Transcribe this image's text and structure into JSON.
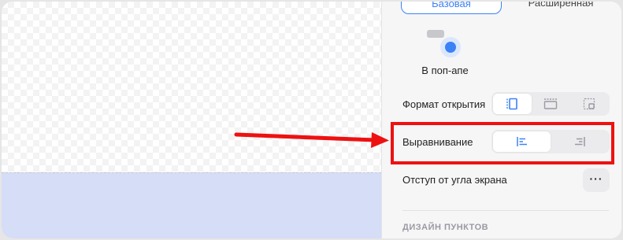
{
  "settings": {
    "tabs": {
      "basic": "Базовая",
      "extended": "Расширенная"
    },
    "display_mode": {
      "label": "В поп-апе",
      "icon": "popup-mode-icon"
    },
    "open_format": {
      "label": "Формат открытия",
      "options": [
        "sidebar-open-icon",
        "top-panel-icon",
        "corner-popup-icon"
      ],
      "selected": 0
    },
    "alignment": {
      "label": "Выравнивание",
      "options": [
        "align-left-icon",
        "align-right-icon"
      ],
      "selected": 0
    },
    "corner_offset": {
      "label": "Отступ от угла экрана",
      "button": "···"
    },
    "section": {
      "title": "ДИЗАЙН ПУНКТОВ"
    }
  },
  "annotation": {
    "color": "#ee1111"
  },
  "colors": {
    "accent": "#3b82f6",
    "canvas_band": "#d6ddf6"
  }
}
